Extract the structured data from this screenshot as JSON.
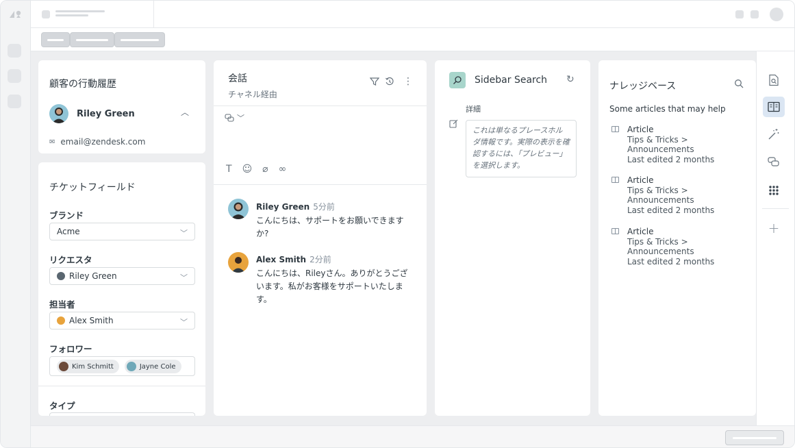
{
  "activity": {
    "title": "顧客の行動履歴",
    "customer_name": "Riley Green",
    "email": "email@zendesk.com"
  },
  "ticket_fields": {
    "title": "チケットフィールド",
    "brand_label": "ブランド",
    "brand_value": "Acme",
    "requester_label": "リクエスタ",
    "requester_value": "Riley Green",
    "assignee_label": "担当者",
    "assignee_value": "Alex Smith",
    "followers_label": "フォロワー",
    "followers": [
      "Kim Schmitt",
      "Jayne Cole"
    ],
    "type_label": "タイプ"
  },
  "conversation": {
    "title": "会話",
    "subtitle": "チャネル経由",
    "messages": [
      {
        "name": "Riley Green",
        "time": "5分前",
        "body": "こんにちは、サポートをお願いできますか?"
      },
      {
        "name": "Alex Smith",
        "time": "2分前",
        "body": "こんにちは、Rileyさん。ありがとうございます。私がお客様をサポートいたします。"
      }
    ]
  },
  "sidebar_search": {
    "title": "Sidebar Search",
    "details_label": "詳細",
    "placeholder": "これは単なるプレースホルダ情報です。実際の表示を確認するには、「プレビュー」を選択します。"
  },
  "knowledge": {
    "title": "ナレッジベース",
    "intro": "Some articles that may help",
    "articles": [
      {
        "type": "Article",
        "path": "Tips & Tricks >",
        "section": "Announcements",
        "edited": "Last edited 2 months"
      },
      {
        "type": "Article",
        "path": "Tips & Tricks >",
        "section": "Announcements",
        "edited": "Last edited 2 months"
      },
      {
        "type": "Article",
        "path": "Tips & Tricks >",
        "section": "Announcements",
        "edited": "Last edited 2 months"
      }
    ]
  },
  "icons": {
    "rail": [
      "logo-icon",
      "app-icon",
      "app-icon",
      "app-icon"
    ],
    "right_rail": [
      "ticket-search-icon",
      "knowledge-icon",
      "magic-wand-icon",
      "chat-icon",
      "apps-grid-icon",
      "add-icon"
    ]
  },
  "colors": {
    "accent_active": "#dbe6f3",
    "search_badge": "#a8d5cb",
    "workspace_bg": "#edeef0"
  }
}
